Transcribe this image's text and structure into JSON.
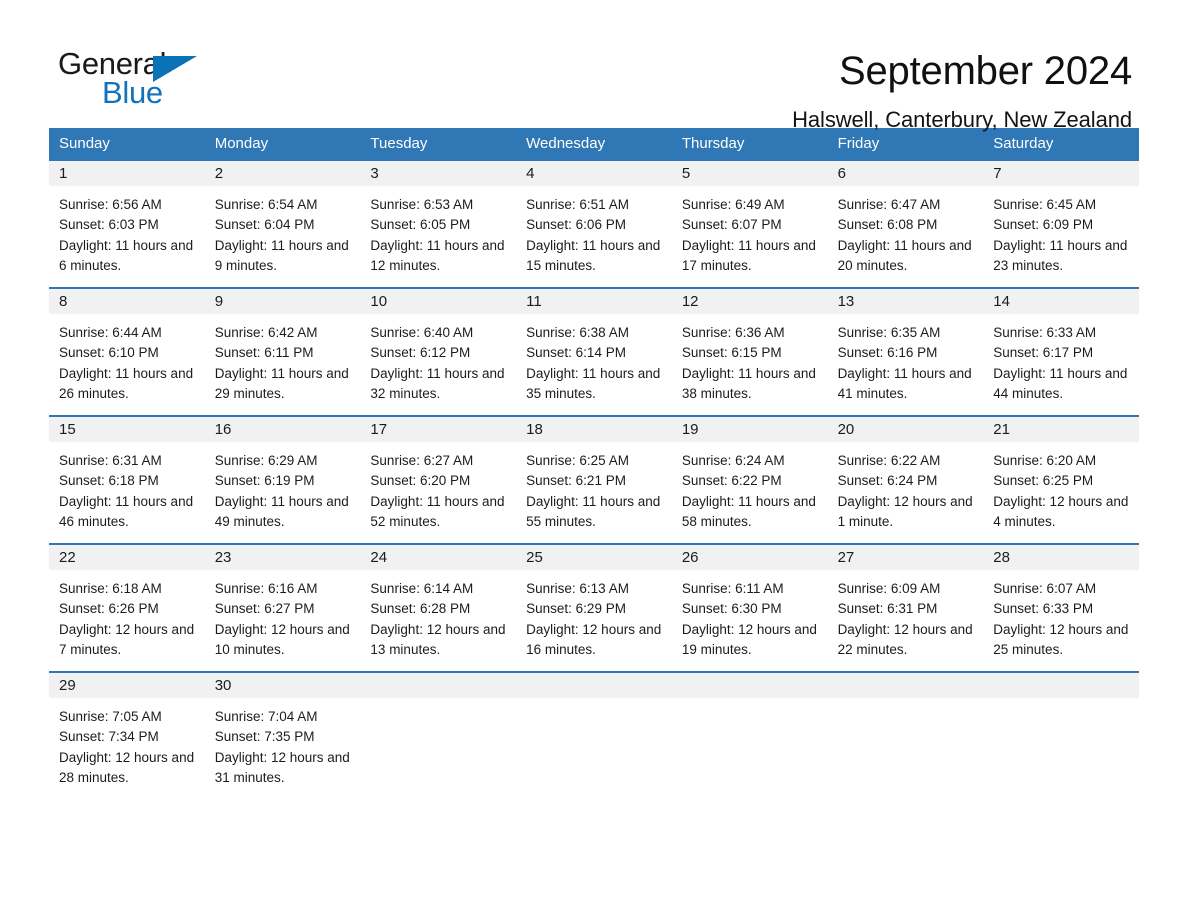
{
  "brand": {
    "word_one": "General",
    "word_two": "Blue",
    "triangle_icon": "brand-triangle-icon",
    "accent_color": "#1272bb"
  },
  "header": {
    "title": "September 2024",
    "subtitle": "Halswell, Canterbury, New Zealand"
  },
  "theme": {
    "header_blue": "#2f77b5",
    "daynum_band": "#f1f1f1",
    "text": "#1c1c1c"
  },
  "weekdays": [
    "Sunday",
    "Monday",
    "Tuesday",
    "Wednesday",
    "Thursday",
    "Friday",
    "Saturday"
  ],
  "labels": {
    "sunrise_prefix": "Sunrise:",
    "sunset_prefix": "Sunset:",
    "daylight_prefix": "Daylight:"
  },
  "weeks": [
    [
      {
        "day": "1",
        "sunrise": "Sunrise: 6:56 AM",
        "sunset": "Sunset: 6:03 PM",
        "daylight": "Daylight: 11 hours and 6 minutes."
      },
      {
        "day": "2",
        "sunrise": "Sunrise: 6:54 AM",
        "sunset": "Sunset: 6:04 PM",
        "daylight": "Daylight: 11 hours and 9 minutes."
      },
      {
        "day": "3",
        "sunrise": "Sunrise: 6:53 AM",
        "sunset": "Sunset: 6:05 PM",
        "daylight": "Daylight: 11 hours and 12 minutes."
      },
      {
        "day": "4",
        "sunrise": "Sunrise: 6:51 AM",
        "sunset": "Sunset: 6:06 PM",
        "daylight": "Daylight: 11 hours and 15 minutes."
      },
      {
        "day": "5",
        "sunrise": "Sunrise: 6:49 AM",
        "sunset": "Sunset: 6:07 PM",
        "daylight": "Daylight: 11 hours and 17 minutes."
      },
      {
        "day": "6",
        "sunrise": "Sunrise: 6:47 AM",
        "sunset": "Sunset: 6:08 PM",
        "daylight": "Daylight: 11 hours and 20 minutes."
      },
      {
        "day": "7",
        "sunrise": "Sunrise: 6:45 AM",
        "sunset": "Sunset: 6:09 PM",
        "daylight": "Daylight: 11 hours and 23 minutes."
      }
    ],
    [
      {
        "day": "8",
        "sunrise": "Sunrise: 6:44 AM",
        "sunset": "Sunset: 6:10 PM",
        "daylight": "Daylight: 11 hours and 26 minutes."
      },
      {
        "day": "9",
        "sunrise": "Sunrise: 6:42 AM",
        "sunset": "Sunset: 6:11 PM",
        "daylight": "Daylight: 11 hours and 29 minutes."
      },
      {
        "day": "10",
        "sunrise": "Sunrise: 6:40 AM",
        "sunset": "Sunset: 6:12 PM",
        "daylight": "Daylight: 11 hours and 32 minutes."
      },
      {
        "day": "11",
        "sunrise": "Sunrise: 6:38 AM",
        "sunset": "Sunset: 6:14 PM",
        "daylight": "Daylight: 11 hours and 35 minutes."
      },
      {
        "day": "12",
        "sunrise": "Sunrise: 6:36 AM",
        "sunset": "Sunset: 6:15 PM",
        "daylight": "Daylight: 11 hours and 38 minutes."
      },
      {
        "day": "13",
        "sunrise": "Sunrise: 6:35 AM",
        "sunset": "Sunset: 6:16 PM",
        "daylight": "Daylight: 11 hours and 41 minutes."
      },
      {
        "day": "14",
        "sunrise": "Sunrise: 6:33 AM",
        "sunset": "Sunset: 6:17 PM",
        "daylight": "Daylight: 11 hours and 44 minutes."
      }
    ],
    [
      {
        "day": "15",
        "sunrise": "Sunrise: 6:31 AM",
        "sunset": "Sunset: 6:18 PM",
        "daylight": "Daylight: 11 hours and 46 minutes."
      },
      {
        "day": "16",
        "sunrise": "Sunrise: 6:29 AM",
        "sunset": "Sunset: 6:19 PM",
        "daylight": "Daylight: 11 hours and 49 minutes."
      },
      {
        "day": "17",
        "sunrise": "Sunrise: 6:27 AM",
        "sunset": "Sunset: 6:20 PM",
        "daylight": "Daylight: 11 hours and 52 minutes."
      },
      {
        "day": "18",
        "sunrise": "Sunrise: 6:25 AM",
        "sunset": "Sunset: 6:21 PM",
        "daylight": "Daylight: 11 hours and 55 minutes."
      },
      {
        "day": "19",
        "sunrise": "Sunrise: 6:24 AM",
        "sunset": "Sunset: 6:22 PM",
        "daylight": "Daylight: 11 hours and 58 minutes."
      },
      {
        "day": "20",
        "sunrise": "Sunrise: 6:22 AM",
        "sunset": "Sunset: 6:24 PM",
        "daylight": "Daylight: 12 hours and 1 minute."
      },
      {
        "day": "21",
        "sunrise": "Sunrise: 6:20 AM",
        "sunset": "Sunset: 6:25 PM",
        "daylight": "Daylight: 12 hours and 4 minutes."
      }
    ],
    [
      {
        "day": "22",
        "sunrise": "Sunrise: 6:18 AM",
        "sunset": "Sunset: 6:26 PM",
        "daylight": "Daylight: 12 hours and 7 minutes."
      },
      {
        "day": "23",
        "sunrise": "Sunrise: 6:16 AM",
        "sunset": "Sunset: 6:27 PM",
        "daylight": "Daylight: 12 hours and 10 minutes."
      },
      {
        "day": "24",
        "sunrise": "Sunrise: 6:14 AM",
        "sunset": "Sunset: 6:28 PM",
        "daylight": "Daylight: 12 hours and 13 minutes."
      },
      {
        "day": "25",
        "sunrise": "Sunrise: 6:13 AM",
        "sunset": "Sunset: 6:29 PM",
        "daylight": "Daylight: 12 hours and 16 minutes."
      },
      {
        "day": "26",
        "sunrise": "Sunrise: 6:11 AM",
        "sunset": "Sunset: 6:30 PM",
        "daylight": "Daylight: 12 hours and 19 minutes."
      },
      {
        "day": "27",
        "sunrise": "Sunrise: 6:09 AM",
        "sunset": "Sunset: 6:31 PM",
        "daylight": "Daylight: 12 hours and 22 minutes."
      },
      {
        "day": "28",
        "sunrise": "Sunrise: 6:07 AM",
        "sunset": "Sunset: 6:33 PM",
        "daylight": "Daylight: 12 hours and 25 minutes."
      }
    ],
    [
      {
        "day": "29",
        "sunrise": "Sunrise: 7:05 AM",
        "sunset": "Sunset: 7:34 PM",
        "daylight": "Daylight: 12 hours and 28 minutes."
      },
      {
        "day": "30",
        "sunrise": "Sunrise: 7:04 AM",
        "sunset": "Sunset: 7:35 PM",
        "daylight": "Daylight: 12 hours and 31 minutes."
      },
      {
        "day": "",
        "sunrise": "",
        "sunset": "",
        "daylight": ""
      },
      {
        "day": "",
        "sunrise": "",
        "sunset": "",
        "daylight": ""
      },
      {
        "day": "",
        "sunrise": "",
        "sunset": "",
        "daylight": ""
      },
      {
        "day": "",
        "sunrise": "",
        "sunset": "",
        "daylight": ""
      },
      {
        "day": "",
        "sunrise": "",
        "sunset": "",
        "daylight": ""
      }
    ]
  ]
}
